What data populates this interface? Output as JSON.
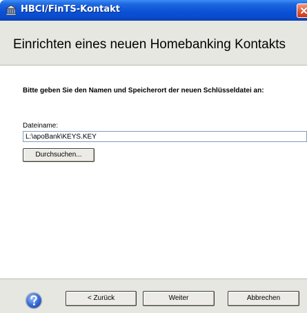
{
  "window": {
    "title": "HBCI/FinTS-Kontakt"
  },
  "header": {
    "title": "Einrichten eines neuen Homebanking Kontakts"
  },
  "main": {
    "instruction": "Bitte geben Sie den Namen und Speicherort der neuen Schlüsseldatei an:",
    "filename_label": "Dateiname:",
    "filename_value": "L:\\apoBank\\KEYS.KEY",
    "browse_label": "Durchsuchen..."
  },
  "footer": {
    "help_icon": "question-mark-icon",
    "back_label": "< Zurück",
    "next_label": "Weiter",
    "cancel_label": "Abbrechen"
  },
  "colors": {
    "titlebar": "#0b52d6",
    "header_bg": "#e7e7e1",
    "close_button": "#e2502b",
    "help_icon": "#2f5fc8"
  }
}
